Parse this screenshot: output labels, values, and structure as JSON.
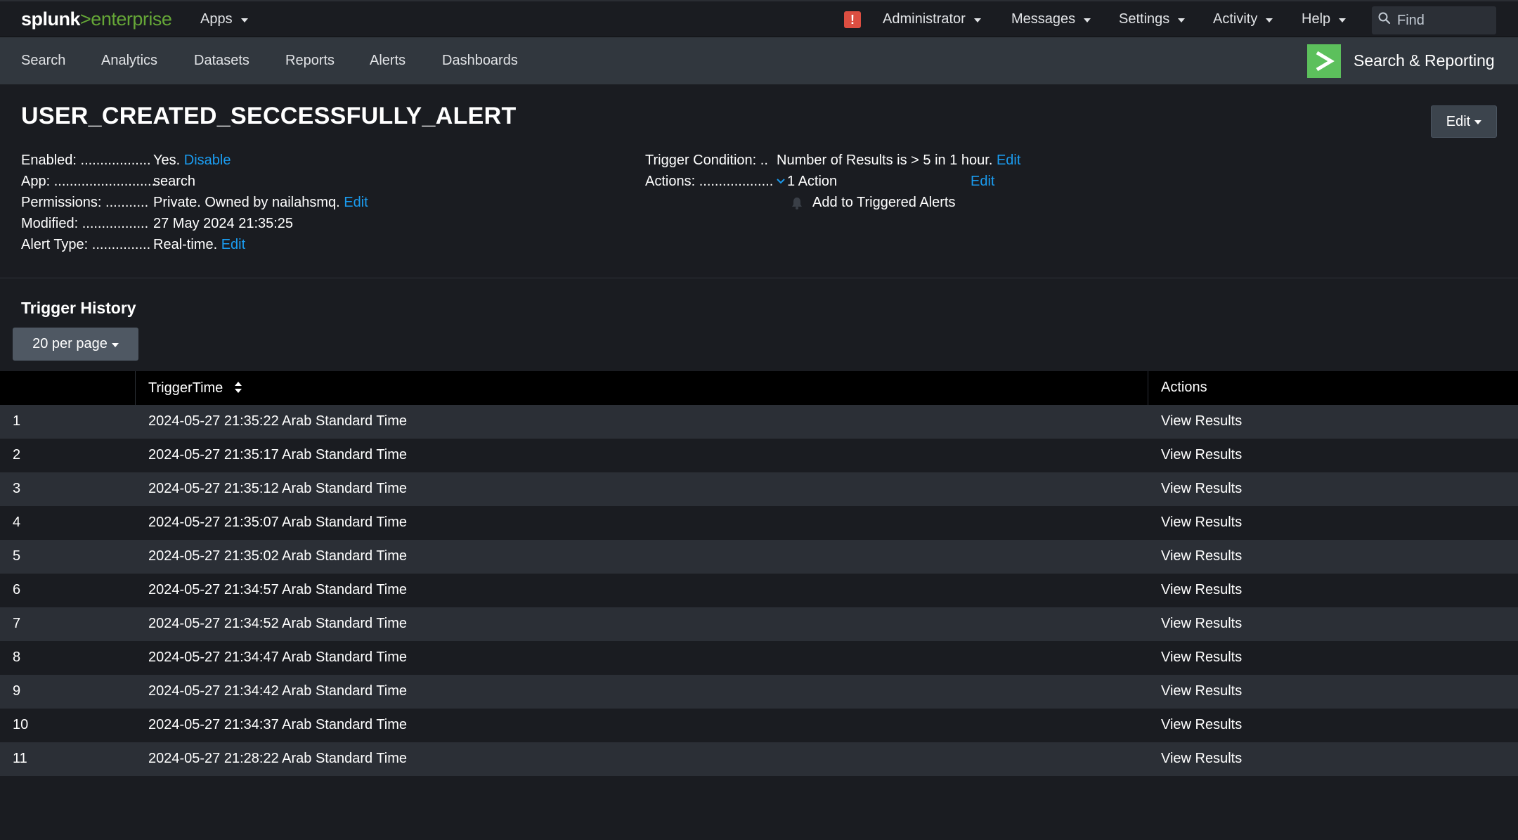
{
  "topbar": {
    "logo": {
      "part1": "splunk",
      "part2": ">",
      "part3": "enterprise"
    },
    "apps_label": "Apps",
    "alert_glyph": "!",
    "menus": [
      "Administrator",
      "Messages",
      "Settings",
      "Activity",
      "Help"
    ],
    "find_placeholder": "Find"
  },
  "appbar": {
    "nav": [
      "Search",
      "Analytics",
      "Datasets",
      "Reports",
      "Alerts",
      "Dashboards"
    ],
    "app_name": "Search & Reporting",
    "app_logo_glyph": ">"
  },
  "alert": {
    "title": "USER_CREATED_SECCESSFULLY_ALERT",
    "edit_button": "Edit",
    "left_fields": [
      {
        "label": "Enabled: ..................",
        "value": "Yes.",
        "link": "Disable"
      },
      {
        "label": "App: ..........................",
        "value": "search",
        "link": ""
      },
      {
        "label": "Permissions: ...........",
        "value": "Private. Owned by nailahsmq.",
        "link": "Edit"
      },
      {
        "label": "Modified: .................",
        "value": "27 May 2024 21:35:25",
        "link": ""
      },
      {
        "label": "Alert Type: ...............",
        "value": "Real-time.",
        "link": "Edit"
      }
    ],
    "trigger_condition_label": "Trigger Condition: ..",
    "trigger_condition_value": "Number of Results is > 5 in 1 hour.",
    "trigger_condition_link": "Edit",
    "actions_label": "Actions: ...................",
    "actions_value": "1 Action",
    "actions_link": "Edit",
    "action_item": "Add to Triggered Alerts"
  },
  "trigger_history": {
    "title": "Trigger History",
    "per_page": "20 per page",
    "columns": {
      "index": "",
      "time": "TriggerTime",
      "actions": "Actions"
    },
    "rows": [
      {
        "n": "1",
        "time": "2024-05-27 21:35:22 Arab Standard Time",
        "action": "View Results"
      },
      {
        "n": "2",
        "time": "2024-05-27 21:35:17 Arab Standard Time",
        "action": "View Results"
      },
      {
        "n": "3",
        "time": "2024-05-27 21:35:12 Arab Standard Time",
        "action": "View Results"
      },
      {
        "n": "4",
        "time": "2024-05-27 21:35:07 Arab Standard Time",
        "action": "View Results"
      },
      {
        "n": "5",
        "time": "2024-05-27 21:35:02 Arab Standard Time",
        "action": "View Results"
      },
      {
        "n": "6",
        "time": "2024-05-27 21:34:57 Arab Standard Time",
        "action": "View Results"
      },
      {
        "n": "7",
        "time": "2024-05-27 21:34:52 Arab Standard Time",
        "action": "View Results"
      },
      {
        "n": "8",
        "time": "2024-05-27 21:34:47 Arab Standard Time",
        "action": "View Results"
      },
      {
        "n": "9",
        "time": "2024-05-27 21:34:42 Arab Standard Time",
        "action": "View Results"
      },
      {
        "n": "10",
        "time": "2024-05-27 21:34:37 Arab Standard Time",
        "action": "View Results"
      },
      {
        "n": "11",
        "time": "2024-05-27 21:28:22 Arab Standard Time",
        "action": "View Results"
      }
    ]
  },
  "colors": {
    "link": "#1a9cf0",
    "brand_green": "#65a637",
    "app_logo": "#5cc05c",
    "alert_red": "#dc4e41"
  }
}
